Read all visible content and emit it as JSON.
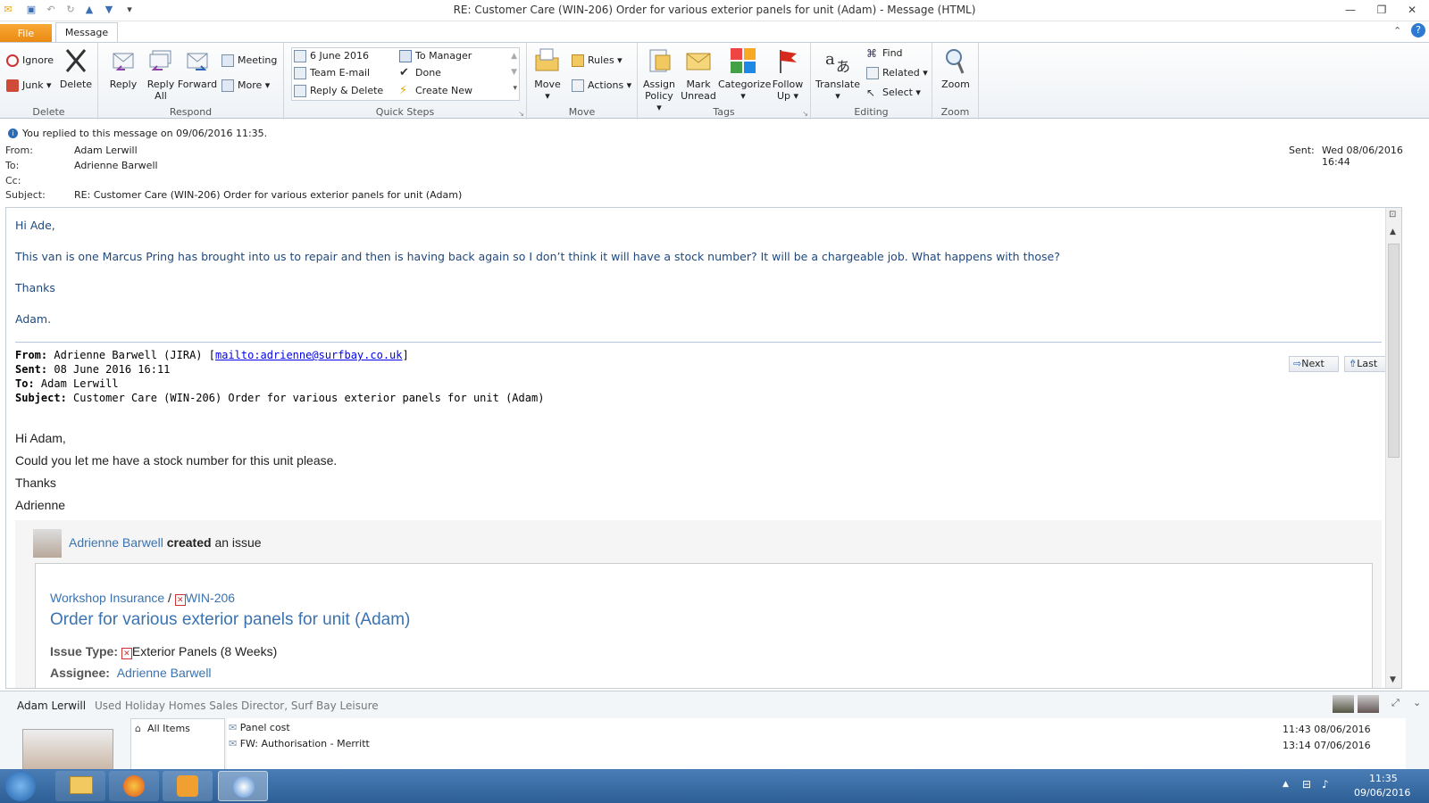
{
  "window": {
    "title": "RE: Customer Care (WIN-206) Order for various exterior panels for unit (Adam)  -  Message (HTML)"
  },
  "tabs": {
    "file": "File",
    "message": "Message"
  },
  "ribbon": {
    "delete_group": {
      "label": "Delete",
      "ignore": "Ignore",
      "junk": "Junk",
      "delete": "Delete"
    },
    "respond_group": {
      "label": "Respond",
      "reply": "Reply",
      "reply_all_1": "Reply",
      "reply_all_2": "All",
      "forward": "Forward",
      "meeting": "Meeting",
      "more": "More"
    },
    "quicksteps_group": {
      "label": "Quick Steps",
      "items": [
        "6 June 2016",
        "Team E-mail",
        "Reply & Delete",
        "To Manager",
        "Done",
        "Create New"
      ]
    },
    "move_group": {
      "label": "Move",
      "move": "Move",
      "rules": "Rules",
      "actions": "Actions"
    },
    "tags_group": {
      "label": "Tags",
      "assign_1": "Assign",
      "assign_2": "Policy",
      "mark_1": "Mark",
      "mark_2": "Unread",
      "categorize": "Categorize",
      "follow_1": "Follow",
      "follow_2": "Up"
    },
    "editing_group": {
      "label": "Editing",
      "translate": "Translate",
      "find": "Find",
      "related": "Related",
      "select": "Select"
    },
    "zoom_group": {
      "label": "Zoom",
      "zoom": "Zoom"
    }
  },
  "infobar": {
    "text": "You replied to this message on 09/06/2016 11:35."
  },
  "header": {
    "from_label": "From:",
    "from": "Adam Lerwill",
    "to_label": "To:",
    "to": "Adrienne Barwell",
    "cc_label": "Cc:",
    "cc": "",
    "subject_label": "Subject:",
    "subject": "RE: Customer Care (WIN-206) Order for various exterior panels for unit (Adam)",
    "sent_label": "Sent:",
    "sent": "Wed 08/06/2016 16:44"
  },
  "reply": {
    "greeting": "Hi Ade,",
    "body": "This van is one Marcus Pring has brought into us to repair and then is having back again so I don’t think it will have a stock number?  It will be a chargeable job.  What happens with those?",
    "thanks": "Thanks",
    "sign": "Adam."
  },
  "quoted": {
    "from_label": "From:",
    "from": "Adrienne Barwell (JIRA) [",
    "from_link": "mailto:adrienne@surfbay.co.uk",
    "from_end": "]",
    "sent_label": "Sent:",
    "sent": "08 June 2016 16:11",
    "to_label": "To:",
    "to": "Adam Lerwill",
    "subject_label": "Subject:",
    "subject": "Customer Care (WIN-206) Order for various exterior panels for unit (Adam)",
    "nav_next": "Next",
    "nav_last": "Last",
    "greeting": "Hi Adam,",
    "line": "Could you let me have a stock number for this unit please.",
    "thanks": "Thanks",
    "sign": "Adrienne"
  },
  "jira": {
    "actor": "Adrienne Barwell",
    "action": "created",
    "action_rest": "an issue",
    "project": "Workshop Insurance",
    "sep": "/",
    "key": "WIN-206",
    "summary": "Order for various exterior panels for unit (Adam)",
    "issue_type_label": "Issue Type:",
    "issue_type": "Exterior Panels (8 Weeks)",
    "assignee_label": "Assignee:",
    "assignee": "Adrienne Barwell"
  },
  "people": {
    "name": "Adam Lerwill",
    "title": "Used Holiday Homes Sales Director, Surf Bay Leisure",
    "all_items": "All Items",
    "items": [
      {
        "subject": "Panel cost",
        "time": "11:43  08/06/2016"
      },
      {
        "subject": "FW: Authorisation - Merritt",
        "time": "13:14  07/06/2016"
      }
    ]
  },
  "taskbar": {
    "time": "11:35",
    "date": "09/06/2016"
  }
}
